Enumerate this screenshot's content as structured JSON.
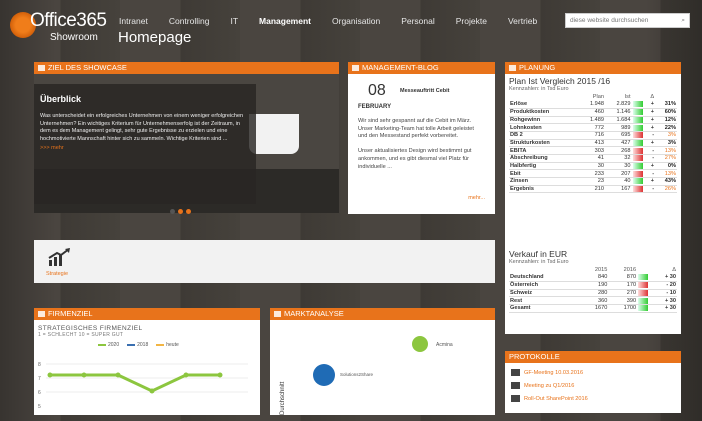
{
  "header": {
    "logo_main": "Office365",
    "logo_sub": "Showroom",
    "page_title": "Homepage",
    "nav": [
      "Intranet",
      "Controlling",
      "IT",
      "Management",
      "Organisation",
      "Personal",
      "Projekte",
      "Vertrieb"
    ],
    "active_nav": "Management",
    "search_placeholder": "diese website durchsuchen"
  },
  "showcase": {
    "header": "ZIEL DES SHOWCASE",
    "title": "Überblick",
    "text": "Was unterscheidet ein erfolgreiches Unternehmen von einem weniger erfolgreichen Unternehmen? Ein wichtiges Kriterium für Unternehmenserfolg ist der Zeitraum, in dem es dem Management gelingt, sehr gute Ergebnisse zu erzielen und eine hochmotivierte Mannschaft hinter sich zu sammeln. Wichtige Kriterien sind ...",
    "more": ">>> mehr"
  },
  "blog": {
    "header": "MANAGEMENT-BLOG",
    "day": "08",
    "month": "FEBRUARY",
    "title": "Messeauftritt Cebit",
    "text": "Wir sind sehr gespannt auf die Cebit im März. Unser Marketing-Team hat tolle Arbeit geleistet und den Messestand perfekt vorbereitet.\n\nUnser aktualisiertes Design wird bestimmt gut ankommen, und es gibt diesmal viel Platz für individuelle ...",
    "more": "mehr..."
  },
  "planung": {
    "header": "PLANUNG",
    "title": "Plan Ist Vergleich 2015 /16",
    "sub": "Kennzahlen: in Tsd Euro",
    "cols": [
      "Plan",
      "Ist",
      "Δ"
    ],
    "rows": [
      [
        "Erlöse",
        "1.948",
        "2.829",
        "+",
        "31%"
      ],
      [
        "Produktkosten",
        "460",
        "1.146",
        "+",
        "60%"
      ],
      [
        "Rohgewinn",
        "1.489",
        "1.684",
        "+",
        "12%"
      ],
      [
        "Lohnkosten",
        "772",
        "989",
        "+",
        "22%"
      ],
      [
        "DB 2",
        "716",
        "695",
        "-",
        "3%"
      ],
      [
        "Strukturkosten",
        "413",
        "427",
        "+",
        "3%"
      ],
      [
        "EBITA",
        "303",
        "268",
        "-",
        "13%"
      ],
      [
        "Abschreibung",
        "41",
        "32",
        "-",
        "27%"
      ],
      [
        "Halbfertig",
        "30",
        "30",
        "+",
        "0%"
      ],
      [
        "Ebit",
        "233",
        "207",
        "-",
        "13%"
      ],
      [
        "Zinsen",
        "23",
        "40",
        "+",
        "43%"
      ],
      [
        "Ergebnis",
        "210",
        "167",
        "-",
        "26%"
      ]
    ]
  },
  "strategie": {
    "label": "Strategie"
  },
  "verkauf": {
    "title": "Verkauf in EUR",
    "sub": "Kennzahlen: in Tsd Euro",
    "cols": [
      "2015",
      "2016",
      "Δ"
    ],
    "rows": [
      [
        "Deutschland",
        "840",
        "870",
        "+ 30"
      ],
      [
        "Österreich",
        "190",
        "170",
        "- 20"
      ],
      [
        "Schweiz",
        "280",
        "270",
        "- 10"
      ],
      [
        "Rest",
        "360",
        "390",
        "+ 30"
      ],
      [
        "Gesamt",
        "1670",
        "1700",
        "+ 30"
      ]
    ]
  },
  "firmenziel": {
    "header": "FIRMENZIEL",
    "title": "STRATEGISCHES FIRMENZIEL",
    "sub": "1 = SCHLECHT 10 = SUPER GUT",
    "legend": [
      "2020",
      "2018",
      "heute"
    ],
    "yticks": [
      "8",
      "7",
      "6",
      "5"
    ]
  },
  "marktanalyse": {
    "header": "MARKTANALYSE",
    "labels": [
      "Acmina",
      "Solutions2Share"
    ],
    "axis": "Durchschnitt"
  },
  "protokolle": {
    "header": "PROTOKOLLE",
    "items": [
      "GF-Meeting 10.03.2016",
      "Meeting zu Q1/2016",
      "Roll-Out SharePoint 2016"
    ]
  },
  "colors": {
    "accent": "#e8731b",
    "positive": "#33aa33",
    "negative": "#dd3333"
  }
}
